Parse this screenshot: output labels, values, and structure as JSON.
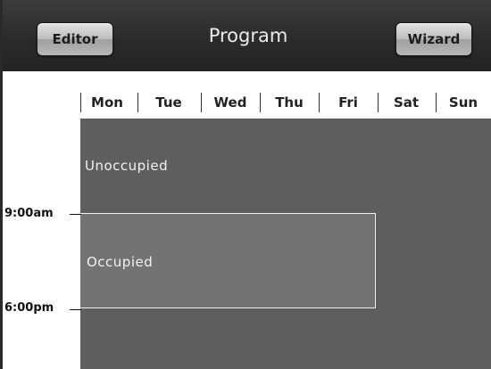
{
  "header": {
    "left_button": "Editor",
    "title": "Program",
    "right_button": "Wizard"
  },
  "days": [
    "Mon",
    "Tue",
    "Wed",
    "Thu",
    "Fri",
    "Sat",
    "Sun"
  ],
  "schedule": {
    "unoccupied_label": "Unoccupied",
    "occupied_label": "Occupied",
    "start_time": "9:00am",
    "end_time": "6:00pm"
  },
  "colors": {
    "header": "#2b2b2b",
    "grid": "#5e5e5e",
    "occupied": "#737373",
    "occupied_border": "#f0f0f0"
  }
}
